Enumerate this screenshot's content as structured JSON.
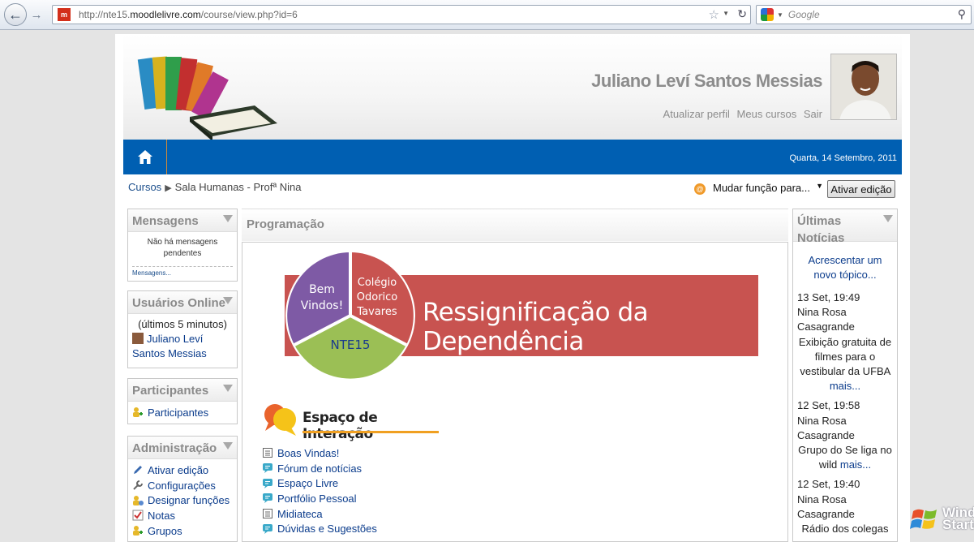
{
  "browser": {
    "url_prefix": "http://nte15.",
    "url_domain": "moodlelivre.com",
    "url_path": "/course/view.php?id=6",
    "search_placeholder": "Google",
    "favicon_label": "m"
  },
  "header": {
    "user_name": "Juliano Leví Santos Messias",
    "links": [
      "Atualizar perfil",
      "Meus cursos",
      "Sair"
    ],
    "date": "Quarta, 14 Setembro, 2011"
  },
  "breadcrumb": {
    "root": "Cursos",
    "current": "Sala Humanas - Profª Nina"
  },
  "controls": {
    "role_select": "Mudar função para...",
    "edit_button": "Ativar edição"
  },
  "blocks": {
    "mensagens": {
      "title": "Mensagens",
      "empty": "Não há mensagens pendentes",
      "link": "Mensagens..."
    },
    "online": {
      "title": "Usuários Online",
      "subtitle": "(últimos 5 minutos)",
      "user": "Juliano Leví Santos Messias"
    },
    "participantes": {
      "title": "Participantes",
      "link": "Participantes"
    },
    "admin": {
      "title": "Administração",
      "items": [
        "Ativar edição",
        "Configurações",
        "Designar funções",
        "Notas",
        "Grupos"
      ]
    },
    "news": {
      "title": "Últimas Notícias",
      "add_topic": "Acrescentar um novo tópico...",
      "items": [
        {
          "date": "13 Set, 19:49",
          "author": "Nina Rosa Casagrande",
          "text": "Exibição gratuita de filmes para o vestibular da UFBA",
          "more": "mais..."
        },
        {
          "date": "12 Set, 19:58",
          "author": "Nina Rosa Casagrande",
          "text": "Grupo do Se liga no wild",
          "more": "mais..."
        },
        {
          "date": "12 Set, 19:40",
          "author": "Nina Rosa Casagrande",
          "text": "Rádio dos colegas",
          "more": ""
        }
      ]
    }
  },
  "center": {
    "title": "Programação",
    "banner": {
      "pie_welcome": "Bem Vindos!",
      "pie_school_1": "Colégio",
      "pie_school_2": "Odorico",
      "pie_school_3": "Tavares",
      "pie_nte": "NTE15",
      "headline": "Ressignificação da Dependência"
    },
    "section_heading": "Espaço de Interação",
    "activities": [
      {
        "label": "Boas Vindas!",
        "icon": "page-icon"
      },
      {
        "label": "Fórum de notícias",
        "icon": "forum-icon"
      },
      {
        "label": "Espaço Livre",
        "icon": "forum-icon"
      },
      {
        "label": "Portfólio Pessoal",
        "icon": "forum-icon"
      },
      {
        "label": "Midiateca",
        "icon": "page-icon"
      },
      {
        "label": "Dúvidas e Sugestões",
        "icon": "forum-icon"
      }
    ]
  },
  "os": {
    "watermark": "Windows Starter"
  },
  "colors": {
    "nav_blue": "#005fb2",
    "banner_red": "#c85350",
    "link_blue": "#0b3c8c"
  }
}
